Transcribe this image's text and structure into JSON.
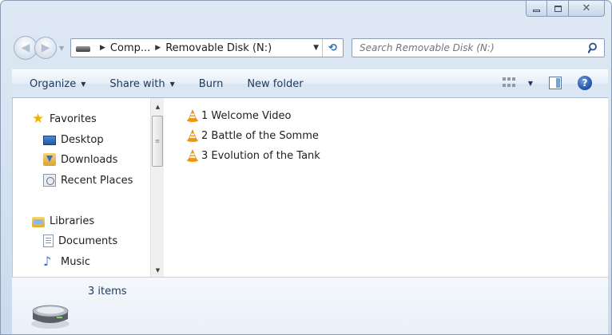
{
  "window": {
    "caption_buttons": [
      {
        "name": "minimize"
      },
      {
        "name": "maximize"
      },
      {
        "name": "close",
        "glyph": "✕"
      }
    ]
  },
  "navigation": {
    "back_glyph": "◀",
    "forward_glyph": "▶",
    "breadcrumbs": [
      "Comp...",
      "Removable Disk (N:)"
    ],
    "refresh_glyph": "⟲"
  },
  "search": {
    "placeholder": "Search Removable Disk (N:)"
  },
  "toolbar": {
    "organize_label": "Organize",
    "share_label": "Share with",
    "burn_label": "Burn",
    "new_folder_label": "New folder",
    "help_glyph": "?"
  },
  "nav_pane": {
    "favorites": {
      "label": "Favorites",
      "items": [
        {
          "label": "Desktop",
          "icon": "desktop-icon"
        },
        {
          "label": "Downloads",
          "icon": "downloads-icon"
        },
        {
          "label": "Recent Places",
          "icon": "recent-places-icon"
        }
      ]
    },
    "libraries": {
      "label": "Libraries",
      "items": [
        {
          "label": "Documents",
          "icon": "documents-icon"
        },
        {
          "label": "Music",
          "icon": "music-icon"
        }
      ]
    }
  },
  "files": [
    {
      "name": "1 Welcome Video",
      "icon": "vlc-media-icon"
    },
    {
      "name": "2 Battle of the Somme",
      "icon": "vlc-media-icon"
    },
    {
      "name": "3 Evolution of the Tank",
      "icon": "vlc-media-icon"
    }
  ],
  "details": {
    "item_count": "3 items",
    "icon": "removable-drive-icon"
  },
  "colors": {
    "frame": "#d3e0ef",
    "toolbar_text": "#1e395b",
    "vlc_orange": "#f39a14"
  }
}
